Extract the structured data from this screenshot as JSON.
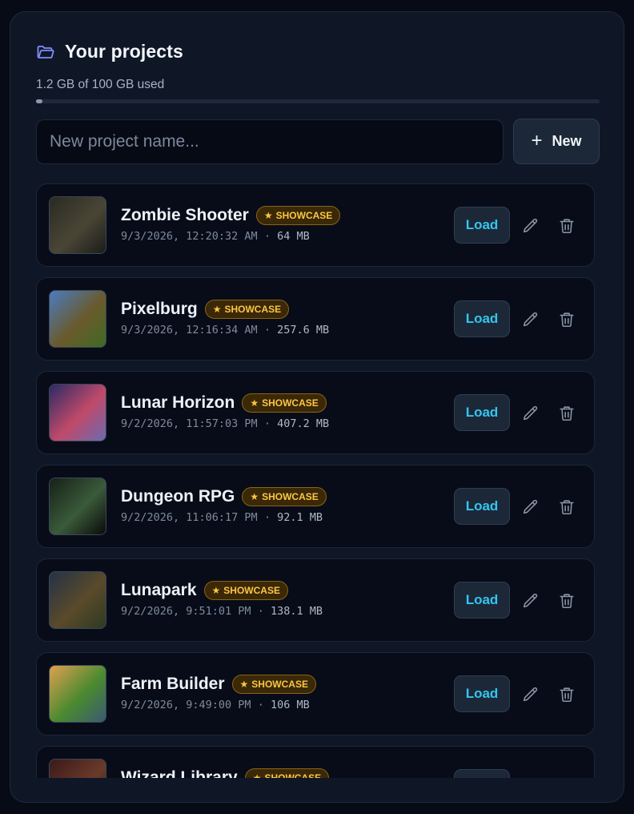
{
  "header": {
    "title": "Your projects",
    "usage_text": "1.2 GB of 100 GB used",
    "usage_fraction": 0.012
  },
  "new_project": {
    "placeholder": "New project name...",
    "value": "",
    "button_label": "New"
  },
  "badge_label": "SHOWCASE",
  "load_label": "Load",
  "projects": [
    {
      "name": "Zombie Shooter",
      "date": "9/3/2026, 12:20:32 AM",
      "size": "64 MB",
      "thumb_colors": [
        "#2a2a22",
        "#4a4636",
        "#1b1c18"
      ]
    },
    {
      "name": "Pixelburg",
      "date": "9/3/2026, 12:16:34 AM",
      "size": "257.6 MB",
      "thumb_colors": [
        "#4a7cc2",
        "#6a5a2c",
        "#3e6a24"
      ]
    },
    {
      "name": "Lunar Horizon",
      "date": "9/2/2026, 11:57:03 PM",
      "size": "407.2 MB",
      "thumb_colors": [
        "#2b2a66",
        "#c04a6a",
        "#6a6ab0"
      ]
    },
    {
      "name": "Dungeon RPG",
      "date": "9/2/2026, 11:06:17 PM",
      "size": "92.1 MB",
      "thumb_colors": [
        "#162016",
        "#3a5a3a",
        "#0a0a0a"
      ]
    },
    {
      "name": "Lunapark",
      "date": "9/2/2026, 9:51:01 PM",
      "size": "138.1 MB",
      "thumb_colors": [
        "#243246",
        "#5a4a2a",
        "#2c3a22"
      ]
    },
    {
      "name": "Farm Builder",
      "date": "9/2/2026, 9:49:00 PM",
      "size": "106 MB",
      "thumb_colors": [
        "#e0a050",
        "#4a8a30",
        "#3a5a70"
      ]
    },
    {
      "name": "Wizard Library",
      "date": "",
      "size": "",
      "thumb_colors": [
        "#3a1a1a",
        "#6a3a2a",
        "#2a1a14"
      ]
    }
  ]
}
